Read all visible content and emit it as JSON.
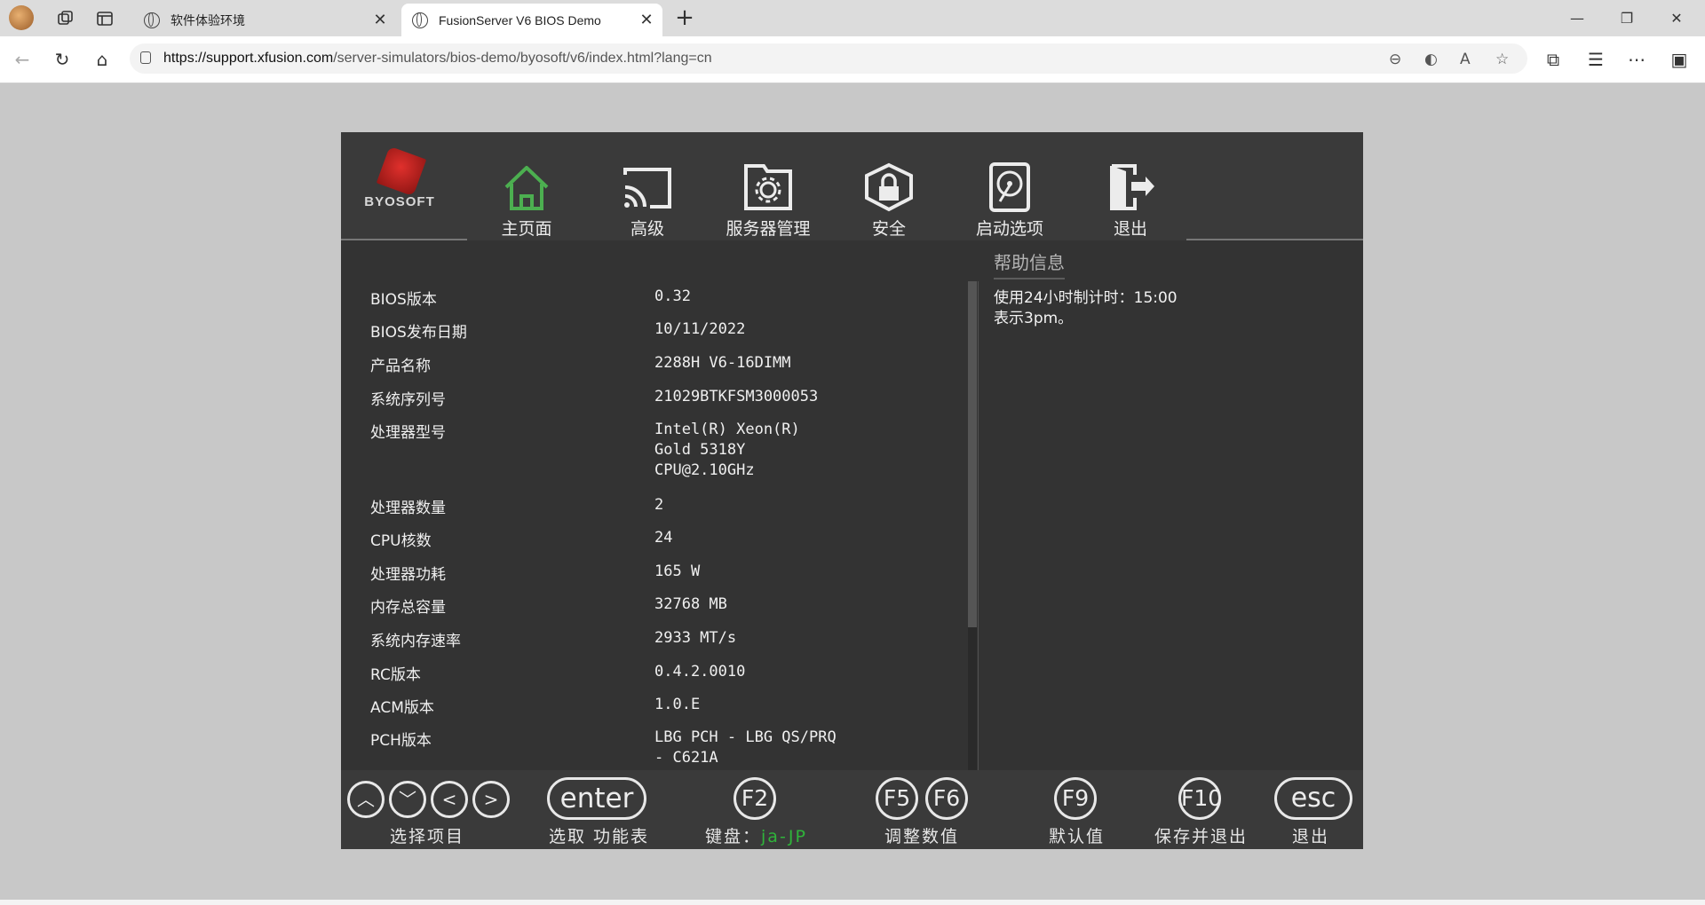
{
  "browser": {
    "tabs": [
      {
        "label": "软件体验环境",
        "active": false
      },
      {
        "label": "FusionServer V6 BIOS Demo",
        "active": true
      }
    ],
    "url_host": "https://support.xfusion.com",
    "url_path": "/server-simulators/bios-demo/byosoft/v6/index.html?lang=cn",
    "icons": [
      "avatar",
      "workspaces-icon",
      "tab-actions-icon",
      "back-icon",
      "refresh-icon",
      "home-icon",
      "zoom-out-icon",
      "edge-icon",
      "read-aloud-icon",
      "favorite-icon",
      "extensions-icon",
      "favorites-icon",
      "more-icon",
      "sidebar-icon"
    ]
  },
  "bios": {
    "logo_text": "BYOSOFT",
    "menu": [
      {
        "label": "主页面",
        "icon": "home-icon",
        "active": true
      },
      {
        "label": "高级",
        "icon": "cast-icon"
      },
      {
        "label": "服务器管理",
        "icon": "gear-folder-icon"
      },
      {
        "label": "安全",
        "icon": "lock-shield-icon"
      },
      {
        "label": "启动选项",
        "icon": "disk-icon"
      },
      {
        "label": "退出",
        "icon": "exit-icon"
      }
    ],
    "info": [
      {
        "label": "BIOS版本",
        "value": "0.32"
      },
      {
        "label": "BIOS发布日期",
        "value": "10/11/2022"
      },
      {
        "label": "产品名称",
        "value": "2288H V6-16DIMM"
      },
      {
        "label": "系统序列号",
        "value": "21029BTKFSM3000053"
      },
      {
        "label": "处理器型号",
        "value": "Intel(R) Xeon(R)\nGold 5318Y\nCPU@2.10GHz"
      },
      {
        "label": "处理器数量",
        "value": "2"
      },
      {
        "label": "CPU核数",
        "value": "24"
      },
      {
        "label": "处理器功耗",
        "value": "165 W"
      },
      {
        "label": "内存总容量",
        "value": "32768 MB"
      },
      {
        "label": "系统内存速率",
        "value": "2933 MT/s"
      },
      {
        "label": "RC版本",
        "value": "0.4.2.0010"
      },
      {
        "label": "ACM版本",
        "value": "1.0.E"
      },
      {
        "label": "PCH版本",
        "value": "LBG PCH - LBG QS/PRQ\n- C621A"
      }
    ],
    "help": {
      "title": "帮助信息",
      "body": "使用24小时制计时：15:00\n表示3pm。"
    },
    "footer": {
      "select_label": "选择项目",
      "enter_key": "enter",
      "enter_label": "选取 功能表",
      "f2_key": "F2",
      "keyboard_label": "键盘：",
      "keyboard_value": "ja-JP",
      "f5_key": "F5",
      "f6_key": "F6",
      "adjust_label": "调整数值",
      "f9_key": "F9",
      "default_label": "默认值",
      "f10_key": "F10",
      "save_label": "保存并退出",
      "esc_key": "esc",
      "exit_label": "退出"
    },
    "colors": {
      "active_menu": "#4caf50",
      "keyboard_value": "#2fb43a",
      "background": "#333333"
    }
  }
}
